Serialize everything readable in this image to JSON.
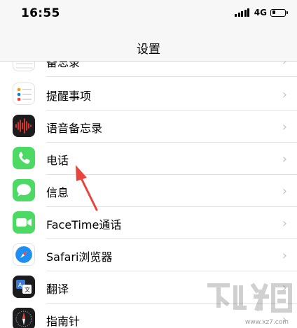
{
  "status_bar": {
    "time": "16:55",
    "network": "4G",
    "battery_level": 0.25
  },
  "nav": {
    "title": "设置"
  },
  "rows": [
    {
      "label": "备忘录",
      "icon": "notes-icon"
    },
    {
      "label": "提醒事项",
      "icon": "reminders-icon"
    },
    {
      "label": "语音备忘录",
      "icon": "voice-memos-icon"
    },
    {
      "label": "电话",
      "icon": "phone-icon"
    },
    {
      "label": "信息",
      "icon": "messages-icon"
    },
    {
      "label": "FaceTime通话",
      "icon": "facetime-icon"
    },
    {
      "label": "Safari浏览器",
      "icon": "safari-icon"
    },
    {
      "label": "翻译",
      "icon": "translate-icon"
    },
    {
      "label": "指南针",
      "icon": "compass-icon"
    }
  ],
  "chevron": "›",
  "watermark": {
    "url": "www.xz7.com"
  },
  "colors": {
    "phone_green": "#4cd964",
    "annotation_red": "#e8453c"
  }
}
